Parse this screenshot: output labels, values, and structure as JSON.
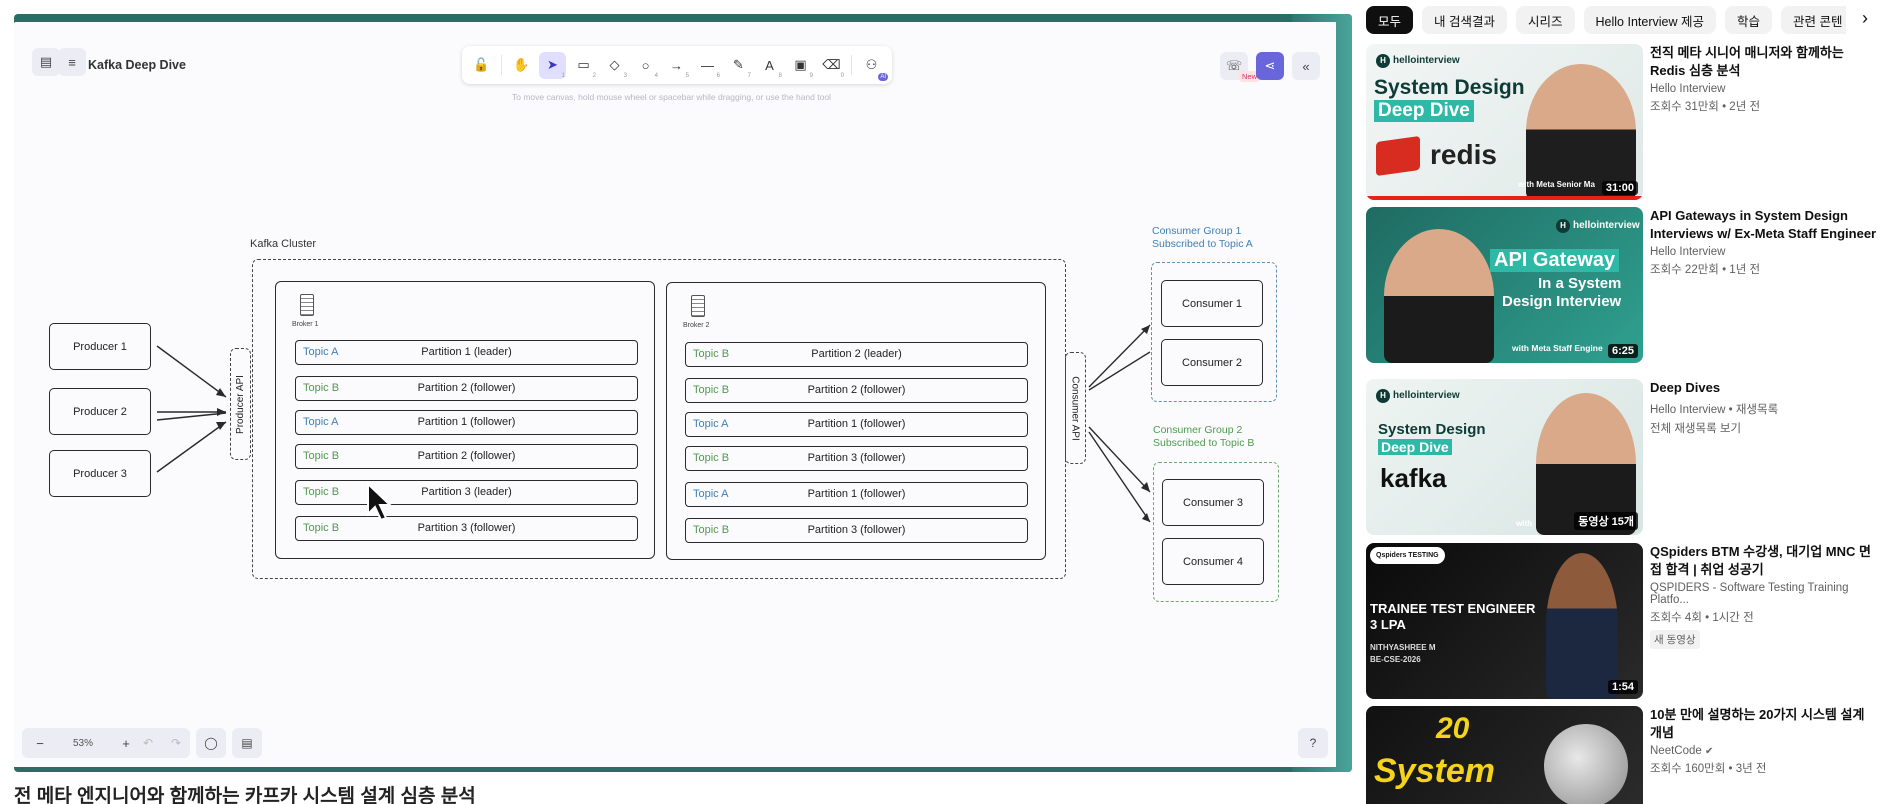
{
  "player": {
    "doc_title": "Kafka Deep Dive",
    "hint": "To move canvas, hold mouse wheel or spacebar while dragging, or use the hand tool",
    "new_badge": "New",
    "zoom": "53%",
    "toolbar": [
      {
        "icon": "lock-icon",
        "glyph": "🔓",
        "num": ""
      },
      {
        "icon": "hand-icon",
        "glyph": "✋",
        "num": ""
      },
      {
        "icon": "selection-icon",
        "glyph": "➤",
        "num": "1",
        "active": true
      },
      {
        "icon": "rectangle-icon",
        "glyph": "▭",
        "num": "2"
      },
      {
        "icon": "diamond-icon",
        "glyph": "◇",
        "num": "3"
      },
      {
        "icon": "ellipse-icon",
        "glyph": "○",
        "num": "4"
      },
      {
        "icon": "arrow-icon",
        "glyph": "→",
        "num": "5"
      },
      {
        "icon": "line-icon",
        "glyph": "—",
        "num": "6"
      },
      {
        "icon": "pencil-icon",
        "glyph": "✎",
        "num": "7"
      },
      {
        "icon": "text-icon",
        "glyph": "A",
        "num": "8"
      },
      {
        "icon": "image-icon",
        "glyph": "▣",
        "num": "9"
      },
      {
        "icon": "eraser-icon",
        "glyph": "⌫",
        "num": "0"
      },
      {
        "icon": "more-tools-icon",
        "glyph": "⚇",
        "num": ""
      }
    ],
    "ai_badge": "AI",
    "below_title": "전 메타 엔지니어와 함께하는 카프카 시스템 설계 심층 분석"
  },
  "diagram": {
    "producers": [
      "Producer 1",
      "Producer 2",
      "Producer 3"
    ],
    "producer_api": "Producer API",
    "consumer_api": "Consumer API",
    "cluster_label": "Kafka Cluster",
    "broker1": {
      "label": "Broker 1",
      "partitions": [
        {
          "topic": "Topic A",
          "kind": "a",
          "name": "Partition 1 (leader)"
        },
        {
          "topic": "Topic B",
          "kind": "b",
          "name": "Partition 2 (follower)"
        },
        {
          "topic": "Topic A",
          "kind": "a",
          "name": "Partition 1 (follower)"
        },
        {
          "topic": "Topic B",
          "kind": "b",
          "name": "Partition 2 (follower)"
        },
        {
          "topic": "Topic B",
          "kind": "b",
          "name": "Partition 3 (leader)"
        },
        {
          "topic": "Topic B",
          "kind": "b",
          "name": "Partition 3 (follower)"
        }
      ]
    },
    "broker2": {
      "label": "Broker 2",
      "partitions": [
        {
          "topic": "Topic B",
          "kind": "b",
          "name": "Partition 2 (leader)"
        },
        {
          "topic": "Topic B",
          "kind": "b",
          "name": "Partition 2 (follower)"
        },
        {
          "topic": "Topic A",
          "kind": "a",
          "name": "Partition 1 (follower)"
        },
        {
          "topic": "Topic B",
          "kind": "b",
          "name": "Partition 3 (follower)"
        },
        {
          "topic": "Topic A",
          "kind": "a",
          "name": "Partition 1 (follower)"
        },
        {
          "topic": "Topic B",
          "kind": "b",
          "name": "Partition 3 (follower)"
        }
      ]
    },
    "group1": {
      "line1": "Consumer Group 1",
      "line2": "Subscribed to Topic A",
      "consumers": [
        "Consumer 1",
        "Consumer 2"
      ]
    },
    "group2": {
      "line1": "Consumer Group 2",
      "line2": "Subscribed to Topic B",
      "consumers": [
        "Consumer 3",
        "Consumer 4"
      ]
    }
  },
  "sidebar": {
    "chips": [
      "모두",
      "내 검색결과",
      "시리즈",
      "Hello Interview 제공",
      "학습",
      "관련 콘텐"
    ],
    "videos": [
      {
        "title": "전직 메타 시니어 매니저와 함께하는 Redis 심층 분석",
        "channel": "Hello Interview",
        "stats": "조회수 31만회 • 2년 전",
        "duration": "31:00",
        "thumb": {
          "logo": "hellointerview",
          "line1": "System Design",
          "line2": "Deep Dive",
          "word": "redis",
          "footer": "with Meta Senior Ma"
        }
      },
      {
        "title": "API Gateways in System Design Interviews w/ Ex-Meta Staff Engineer",
        "channel": "Hello Interview",
        "stats": "조회수 22만회 • 1년 전",
        "duration": "6:25",
        "thumb": {
          "logo": "hellointerview",
          "line1": "API Gateway",
          "line2": "In a System",
          "line3": "Design Interview",
          "footer": "with Meta Staff Engine"
        }
      },
      {
        "title": "Deep Dives",
        "channel": "Hello Interview • 재생목록",
        "stats": "전체 재생목록 보기",
        "duration": "동영상 15개",
        "thumb": {
          "logo": "hellointerview",
          "line1": "System Design",
          "line2": "Deep Dive",
          "word": "kafka",
          "footer": "with"
        }
      },
      {
        "title": "QSpiders BTM 수강생, 대기업 MNC 면접 합격 | 취업 성공기",
        "channel": "QSPIDERS - Software Testing Training Platfo...",
        "stats": "조회수 4회 • 1시간 전",
        "badge": "새 동영상",
        "duration": "1:54",
        "thumb": {
          "logo": "Qspiders TESTING",
          "line1": "TRAINEE TEST ENGINEER",
          "line2": "3 LPA",
          "line3": "NITHYASHREE M",
          "line4": "BE-CSE-2026"
        }
      },
      {
        "title": "10분 만에 설명하는 20가지 시스템 설계 개념",
        "channel": "NeetCode",
        "stats": "조회수 160만회 • 3년 전",
        "thumb": {
          "line1": "20",
          "line2": "System"
        }
      }
    ]
  },
  "colors": {
    "accent": "#6965db",
    "topic_a": "#3f7fb6",
    "topic_b": "#4f9a4f",
    "player_bg": "#2c6b66"
  }
}
